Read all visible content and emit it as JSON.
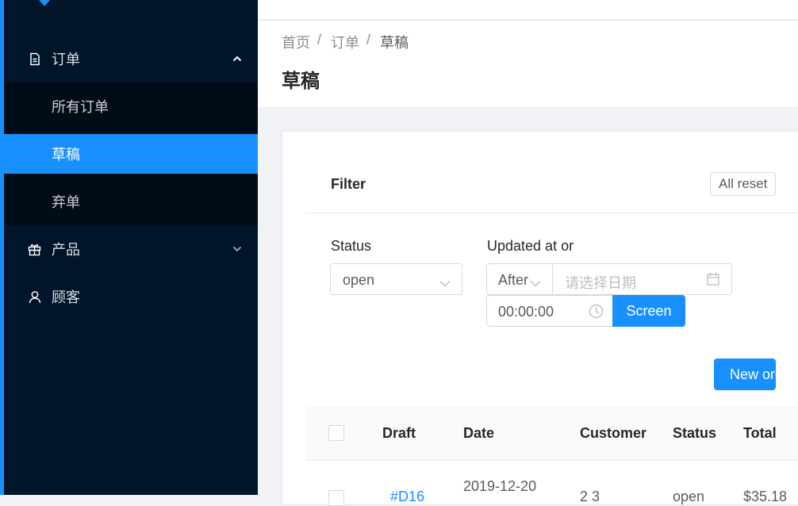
{
  "sidebar": {
    "menu": [
      {
        "label": "订单",
        "icon": "file-icon",
        "expanded": true
      },
      {
        "label": "产品",
        "icon": "gift-icon",
        "expanded": false
      },
      {
        "label": "顾客",
        "icon": "user-icon",
        "expanded": false
      }
    ],
    "orders_submenu": [
      "所有订单",
      "草稿",
      "弃单"
    ],
    "active_item": "草稿"
  },
  "breadcrumb": [
    "首页",
    "订单",
    "草稿"
  ],
  "breadcrumb_separator": "/",
  "page_title": "草稿",
  "filter": {
    "title": "Filter",
    "reset_label": "All reset",
    "status_label": "Status",
    "status_value": "open",
    "updated_label": "Updated at or",
    "compare_value": "After",
    "date_placeholder": "请选择日期",
    "time_value": "00:00:00",
    "screen_label": "Screen"
  },
  "new_order_label": "New order",
  "table": {
    "columns": [
      "Draft",
      "Date",
      "Customer",
      "Status",
      "Total"
    ],
    "rows": [
      {
        "draft": "#D16",
        "date": "2019-12-20",
        "customer": "2 3",
        "status": "open",
        "total": "$35.18"
      }
    ]
  },
  "colors": {
    "primary": "#1890ff",
    "sidebar_bg": "#001529",
    "submenu_bg": "#000c17"
  }
}
